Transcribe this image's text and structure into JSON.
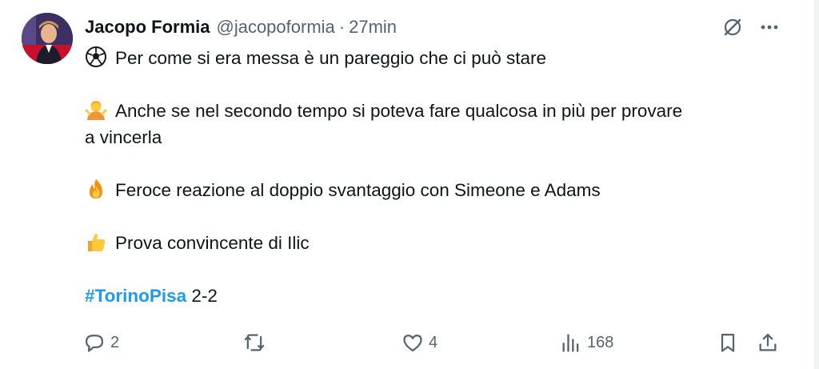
{
  "tweet": {
    "author_name": "Jacopo Formia",
    "handle": "@jacopoformia",
    "separator": "·",
    "time": "27min",
    "lines": {
      "l1": "Per come si era messa è un pareggio che ci può stare",
      "l2a": "Anche se nel secondo tempo si poteva fare qualcosa in più per provare",
      "l2b": "a vincerla",
      "l3": "Feroce reazione al doppio svantaggio con Simeone e Adams",
      "l4": "Prova convincente di Ilic"
    },
    "hashtag": "#TorinoPisa",
    "score": " 2-2",
    "emojis": [
      "soccer-ball-icon",
      "shrugging-person-icon",
      "fire-icon",
      "thumbs-up-icon"
    ]
  },
  "actions": {
    "replies": "2",
    "reposts": "",
    "likes": "4",
    "views": "168"
  },
  "colors": {
    "text": "#0f1419",
    "muted": "#536471",
    "link": "#1d9bf0"
  }
}
